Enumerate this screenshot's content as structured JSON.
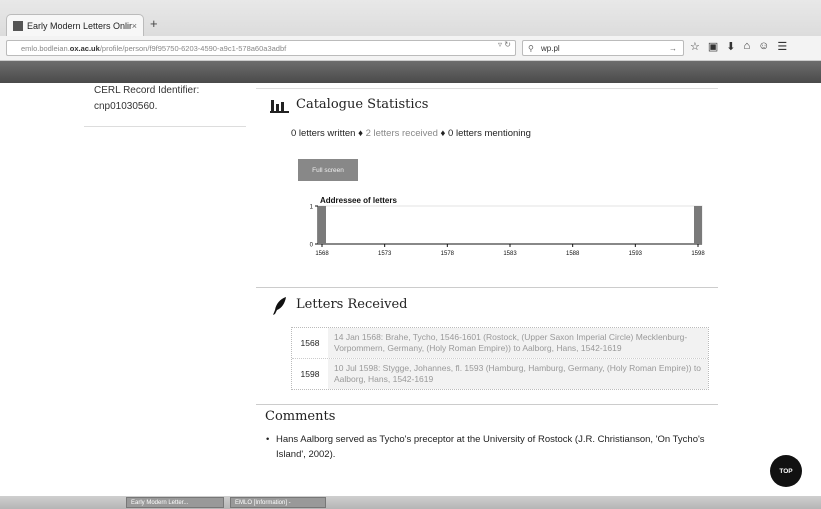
{
  "browser": {
    "tab_title": "Early Modern Letters Onlin...",
    "tab_close": "×",
    "new_tab": "+",
    "url_prefix": "emlo.bodleian.",
    "url_domain": "ox.ac.uk",
    "url_path": "/profile/person/f9f95750-6203-4590-a9c1-578a60a3adbf",
    "search_value": "wp.pl"
  },
  "left": {
    "cerl_label": "CERL Record Identifier:",
    "cerl_value": "cnp01030560."
  },
  "stats": {
    "heading": "Catalogue Statistics",
    "written": "0 letters written",
    "sep": "♦",
    "received": "2 letters received",
    "mentioning": "0 letters mentioning",
    "fullscreen_label": "Full screen"
  },
  "chart_data": {
    "type": "bar",
    "title": "Addressee of letters",
    "categories": [
      "1568",
      "1598"
    ],
    "values": [
      1,
      1
    ],
    "x_ticks": [
      "1568",
      "1573",
      "1578",
      "1583",
      "1588",
      "1593",
      "1598"
    ],
    "y_ticks": [
      "0",
      "1"
    ],
    "xlim": [
      1568,
      1598
    ],
    "ylim": [
      0,
      1
    ],
    "bar_color": "#7a7a7a"
  },
  "received": {
    "heading": "Letters Received",
    "rows": [
      {
        "year": "1568",
        "text": "14 Jan 1568: Brahe, Tycho, 1546-1601 (Rostock, (Upper Saxon Imperial Circle) Mecklenburg-Vorpommern, Germany, (Holy Roman Empire)) to Aalborg, Hans, 1542-1619"
      },
      {
        "year": "1598",
        "text": "10 Jul 1598: Stygge, Johannes, fl. 1593 (Hamburg, Hamburg, Germany, (Holy Roman Empire)) to Aalborg, Hans, 1542-1619"
      }
    ]
  },
  "comments": {
    "heading": "Comments",
    "text": "Hans Aalborg served as Tycho's preceptor at the University of Rostock (J.R. Christianson, 'On Tycho's Island', 2002)."
  },
  "top_button": "TOP",
  "taskbar": {
    "item1": "Early Modern Letter...",
    "item2": "EMLO [Information] -"
  }
}
